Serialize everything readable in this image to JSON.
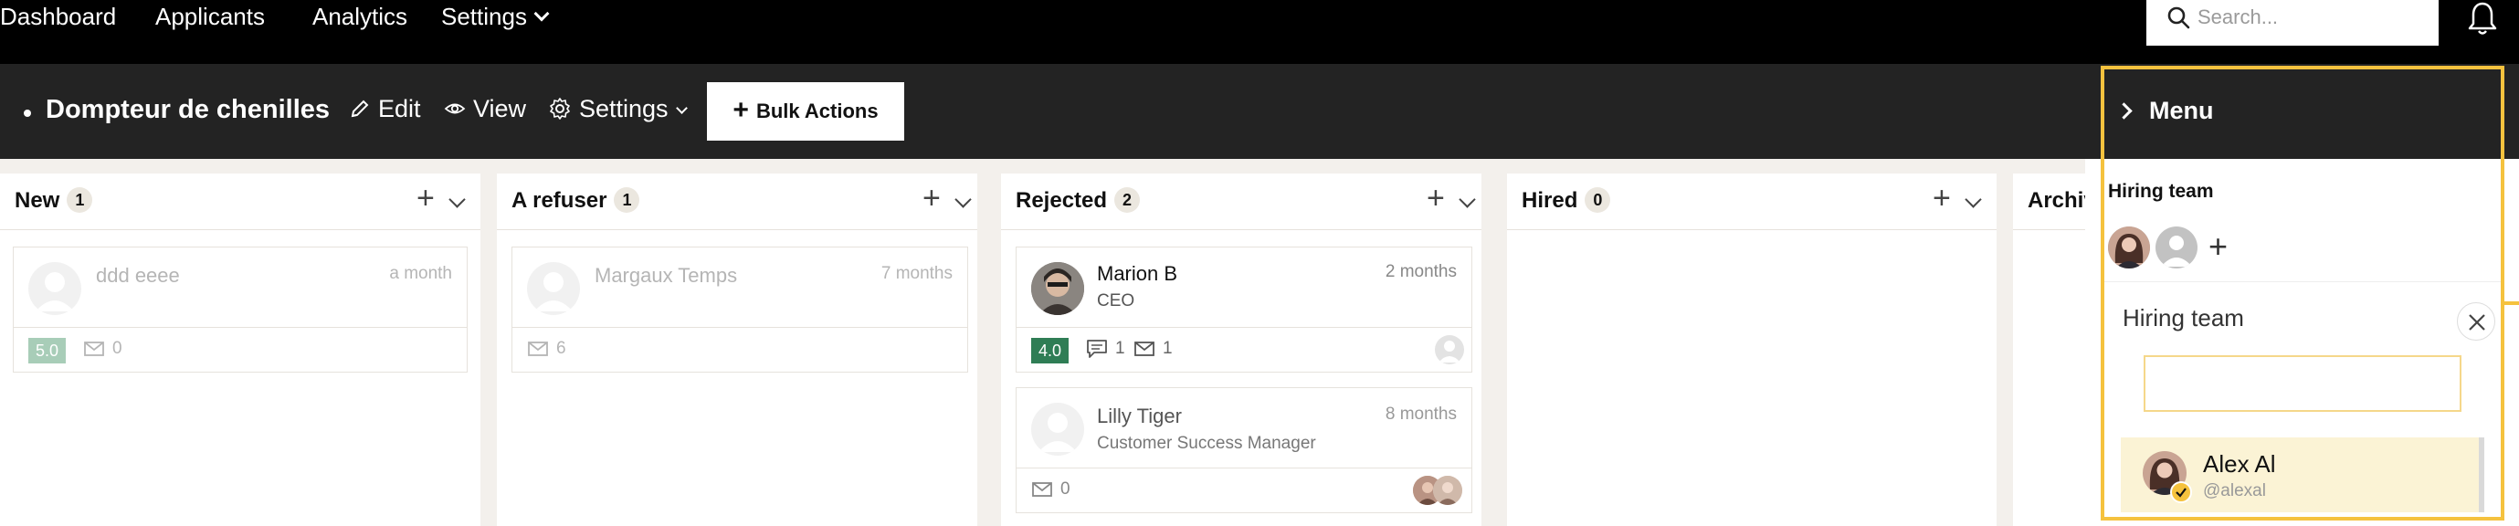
{
  "nav": {
    "links": [
      "Dashboard",
      "Applicants",
      "Analytics",
      "Settings"
    ],
    "search_placeholder": "Search..."
  },
  "job": {
    "title": "Dompteur de chenilles",
    "edit_label": "Edit",
    "view_label": "View",
    "settings_label": "Settings",
    "bulk_label": "Bulk Actions"
  },
  "columns": [
    {
      "title": "New",
      "count": "1",
      "cards": [
        {
          "name": "ddd eeee",
          "time": "a month",
          "rating": "5.0",
          "rating_color": "#a8cdb8",
          "messages": "0",
          "faded": true
        }
      ]
    },
    {
      "title": "A refuser",
      "count": "1",
      "cards": [
        {
          "name": "Margaux Temps",
          "time": "7 months",
          "messages": "6",
          "faded": true
        }
      ]
    },
    {
      "title": "Rejected",
      "count": "2",
      "cards": [
        {
          "name": "Marion B",
          "subtitle": "CEO",
          "time": "2 months",
          "rating": "4.0",
          "rating_color": "#2f7d55",
          "comments": "1",
          "messages": "1"
        },
        {
          "name": "Lilly Tiger",
          "subtitle": "Customer Success Manager",
          "time": "8 months",
          "messages": "0"
        }
      ]
    },
    {
      "title": "Hired",
      "count": "0",
      "cards": []
    },
    {
      "title": "Archiv",
      "cards": []
    }
  ],
  "menu": {
    "title": "Menu",
    "hiring_team_label": "Hiring team",
    "popover": {
      "title": "Hiring team",
      "input_value": "",
      "option": {
        "name": "Alex Al",
        "handle": "@alexal"
      }
    }
  },
  "colors": {
    "accent": "#f5c23e",
    "dark": "#232323",
    "rating_green": "#2f7d55"
  }
}
